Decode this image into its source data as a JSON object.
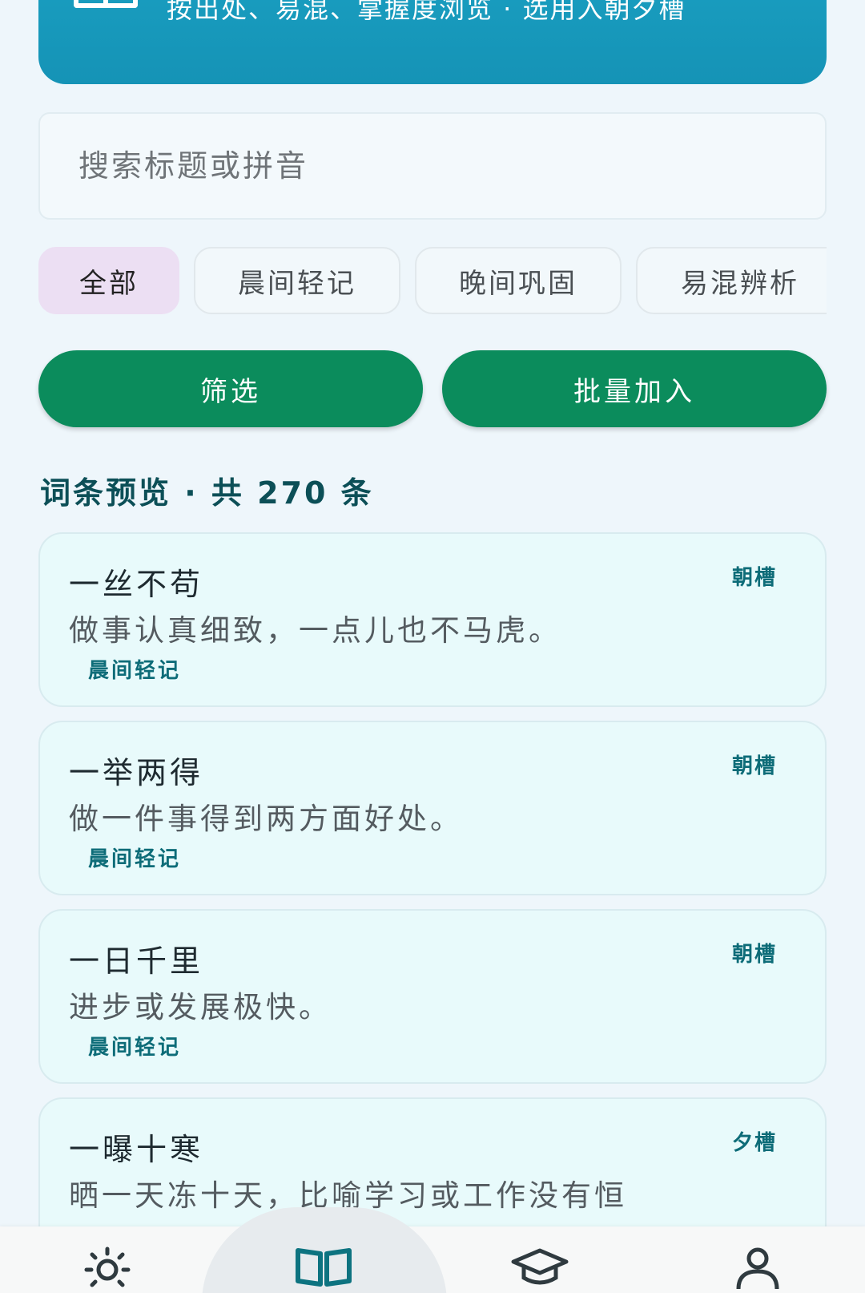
{
  "banner": {
    "text": "按出处、易混、掌握度浏览 · 选用入朝夕槽"
  },
  "search": {
    "placeholder": "搜索标题或拼音",
    "value": ""
  },
  "chips": [
    {
      "label": "全部",
      "active": true
    },
    {
      "label": "晨间轻记",
      "active": false
    },
    {
      "label": "晚间巩固",
      "active": false
    },
    {
      "label": "易混辨析",
      "active": false
    }
  ],
  "actions": {
    "filter_label": "筛选",
    "batch_add_label": "批量加入"
  },
  "section": {
    "title": "词条预览 · 共 270 条"
  },
  "entries": [
    {
      "title": "一丝不苟",
      "slot": "朝槽",
      "desc": "做事认真细致，一点儿也不马虎。",
      "tag": "晨间轻记"
    },
    {
      "title": "一举两得",
      "slot": "朝槽",
      "desc": "做一件事得到两方面好处。",
      "tag": "晨间轻记"
    },
    {
      "title": "一日千里",
      "slot": "朝槽",
      "desc": "进步或发展极快。",
      "tag": "晨间轻记"
    },
    {
      "title": "一曝十寒",
      "slot": "夕槽",
      "desc": "晒一天冻十天，比喻学习或工作没有恒",
      "tag": ""
    }
  ],
  "nav": {
    "items": [
      {
        "icon": "sun-icon"
      },
      {
        "icon": "book-icon",
        "active": true
      },
      {
        "icon": "graduation-cap-icon"
      },
      {
        "icon": "user-icon"
      }
    ]
  },
  "colors": {
    "banner": "#1593b6",
    "primary_button": "#0b8c5c",
    "accent_text": "#0d6c78",
    "active_chip": "#ecdff3",
    "card_bg": "#e8fafb"
  }
}
